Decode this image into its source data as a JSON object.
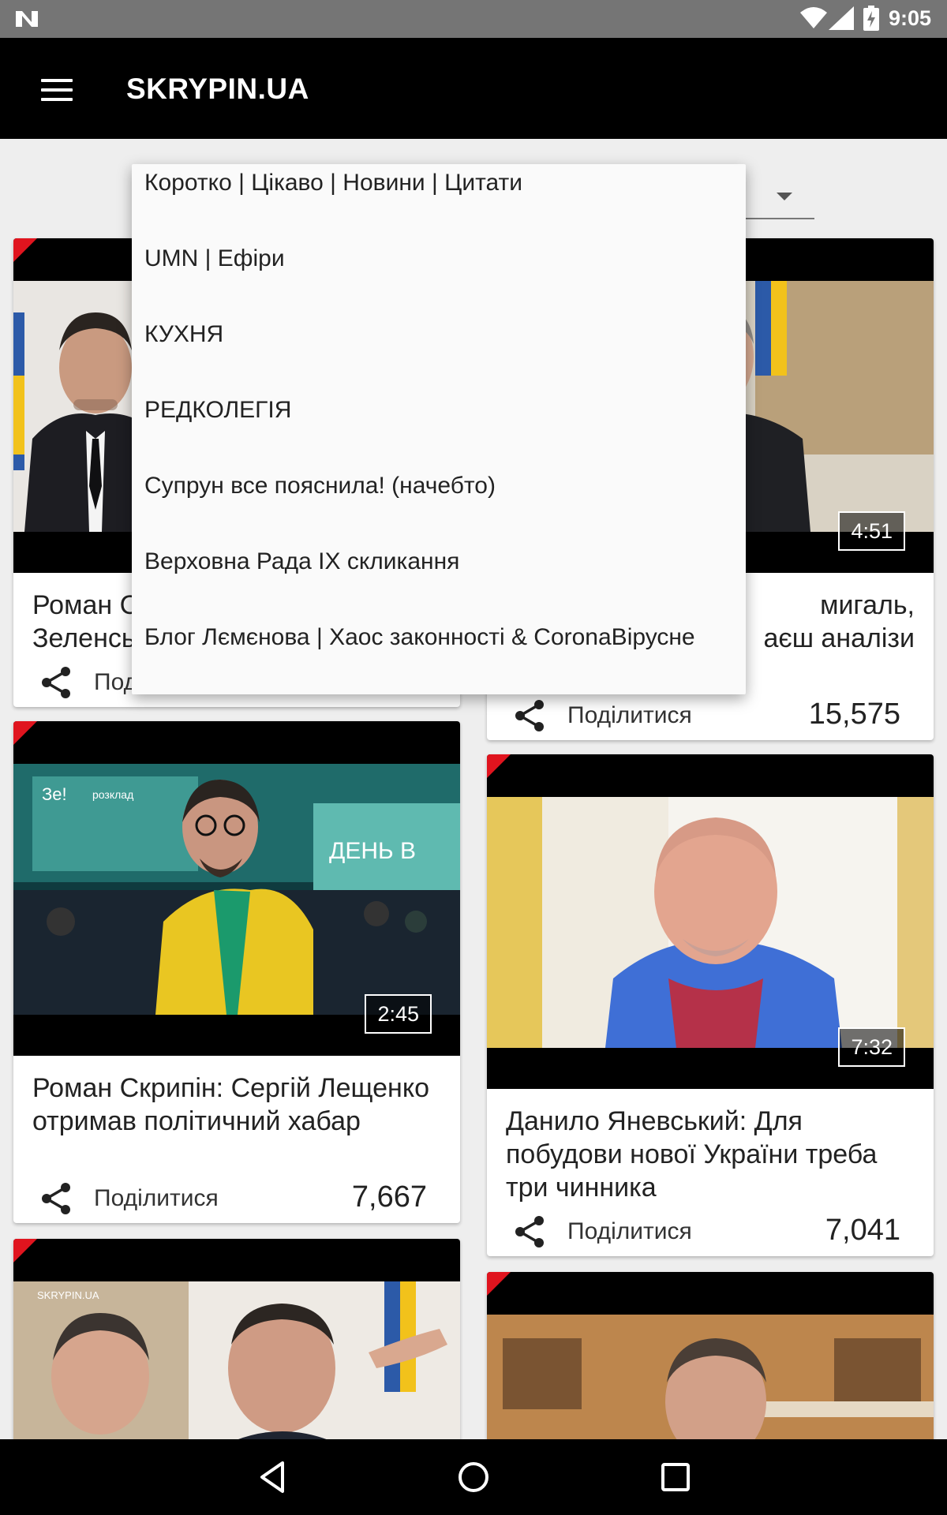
{
  "status_bar": {
    "time": "9:05",
    "icons": [
      "notification-n-icon",
      "wifi-icon",
      "signal-icon",
      "battery-charging-icon"
    ]
  },
  "app_bar": {
    "title": "SKRYPIN.UA",
    "menu_icon": "hamburger-menu-icon"
  },
  "dropdown": {
    "items": [
      "Коротко | Цікаво | Новини | Цитати",
      "UMN | Ефіри",
      "КУХНЯ",
      "РЕДКОЛЕГІЯ",
      "Супрун все пояснила! (начебто)",
      "Верховна Рада IX скликання",
      "Блог Лємєнова | Хаос законності & CoronaВірусне"
    ]
  },
  "cards": [
    {
      "caption_visible_left": "Роман С",
      "caption_visible_left_line2": "Зеленсь",
      "share_label_partial": "Под",
      "photo": "zelensky-photo"
    },
    {
      "caption_visible_right": "мигаль,",
      "caption_visible_right_line2": "аєш аналізи",
      "duration": "4:51",
      "share_label": "Поділитися",
      "views": "15,575",
      "photo": "shmyhal-photo"
    },
    {
      "caption": "Роман Скрипін: Сергій Лещенко отримав політичний хабар",
      "duration": "2:45",
      "share_label": "Поділитися",
      "views": "7,667",
      "photo": "leshchenko-photo",
      "photo_text": [
        "Зе!",
        "розклад",
        "ДЕНЬ В"
      ]
    },
    {
      "caption": "Данило Яневський: Для побудови нової України треба три чинника",
      "duration": "7:32",
      "share_label": "Поділитися",
      "views": "7,041",
      "photo": "yanevsky-photo"
    },
    {
      "photo": "skrypin-avakov-photo",
      "watermark": "SKRYPIN.UA"
    },
    {
      "photo": "skrypin-kitchen-photo"
    }
  ],
  "nav_bar": {
    "icons": [
      "back-icon",
      "home-icon",
      "recents-icon"
    ]
  },
  "colors": {
    "accent_red": "#e0141e",
    "app_bar": "#000000",
    "status_bar": "#757575"
  }
}
